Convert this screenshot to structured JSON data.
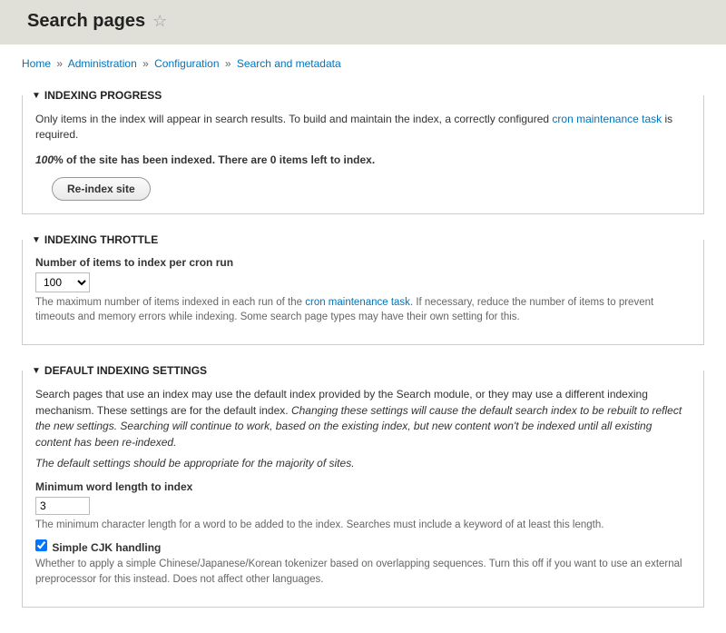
{
  "header": {
    "title": "Search pages"
  },
  "breadcrumbs": {
    "items": [
      "Home",
      "Administration",
      "Configuration",
      "Search and metadata"
    ],
    "separator": "»"
  },
  "panels": {
    "progress": {
      "heading": "Indexing Progress",
      "intro_pre": "Only items in the index will appear in search results. To build and maintain the index, a correctly configured ",
      "intro_link": "cron maintenance task",
      "intro_post": " is required.",
      "status_pct": "100",
      "status_mid": "% of the site has been indexed. There are ",
      "status_left": "0",
      "status_suffix": " items left to index.",
      "reindex_button": "Re-index site"
    },
    "throttle": {
      "heading": "Indexing Throttle",
      "label": "Number of items to index per cron run",
      "value": "100",
      "desc_pre": "The maximum number of items indexed in each run of the ",
      "desc_link": "cron maintenance task",
      "desc_post": ". If necessary, reduce the number of items to prevent timeouts and memory errors while indexing. Some search page types may have their own setting for this."
    },
    "defaults": {
      "heading": "Default Indexing Settings",
      "para1_plain": "Search pages that use an index may use the default index provided by the Search module, or they may use a different indexing mechanism. These settings are for the default index. ",
      "para1_em": "Changing these settings will cause the default search index to be rebuilt to reflect the new settings. Searching will continue to work, based on the existing index, but new content won't be indexed until all existing content has been re-indexed.",
      "para2_em": "The default settings should be appropriate for the majority of sites.",
      "min_word_label": "Minimum word length to index",
      "min_word_value": "3",
      "min_word_desc": "The minimum character length for a word to be added to the index. Searches must include a keyword of at least this length.",
      "cjk_label": "Simple CJK handling",
      "cjk_checked": true,
      "cjk_desc": "Whether to apply a simple Chinese/Japanese/Korean tokenizer based on overlapping sequences. Turn this off if you want to use an external preprocessor for this instead. Does not affect other languages."
    }
  }
}
